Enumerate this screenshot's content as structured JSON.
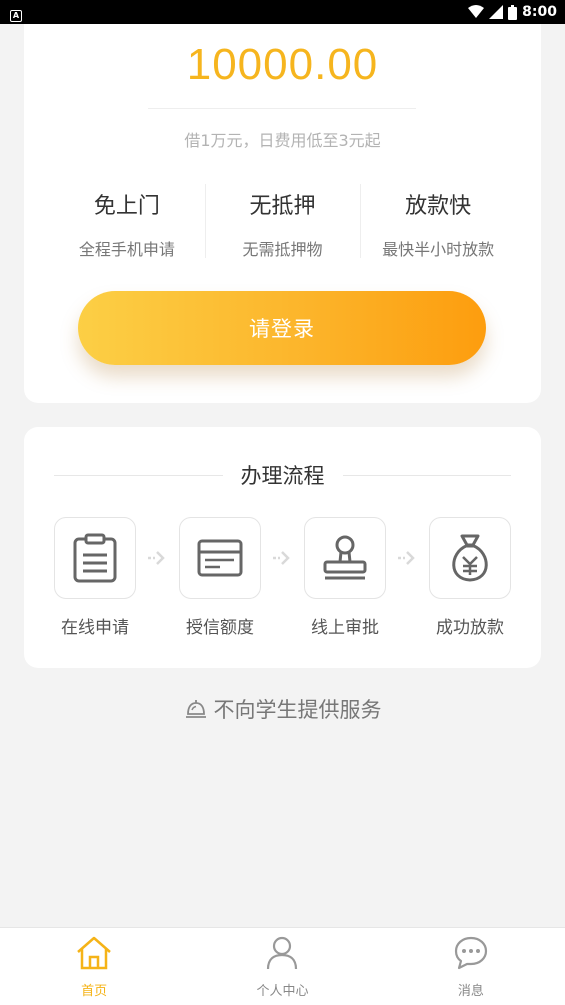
{
  "status_bar": {
    "app_badge": "A",
    "time": "8:00"
  },
  "hero": {
    "amount": "10000.00",
    "sub_note": "借1万元，日费用低至3元起",
    "accent_color": "#f6b51e"
  },
  "features": [
    {
      "title": "免上门",
      "desc": "全程手机申请"
    },
    {
      "title": "无抵押",
      "desc": "无需抵押物"
    },
    {
      "title": "放款快",
      "desc": "最快半小时放款"
    }
  ],
  "login_button": {
    "label": "请登录"
  },
  "process": {
    "title": "办理流程",
    "steps": [
      {
        "label": "在线申请",
        "icon": "clipboard-icon"
      },
      {
        "label": "授信额度",
        "icon": "card-icon"
      },
      {
        "label": "线上审批",
        "icon": "stamp-icon"
      },
      {
        "label": "成功放款",
        "icon": "money-bag-icon"
      }
    ]
  },
  "notice": {
    "text": "不向学生提供服务",
    "icon": "bell-icon"
  },
  "bottom_nav": {
    "items": [
      {
        "label": "首页",
        "icon": "home-icon",
        "active": true
      },
      {
        "label": "个人中心",
        "icon": "user-icon",
        "active": false
      },
      {
        "label": "消息",
        "icon": "chat-icon",
        "active": false
      }
    ],
    "active_color": "#f5b317"
  }
}
